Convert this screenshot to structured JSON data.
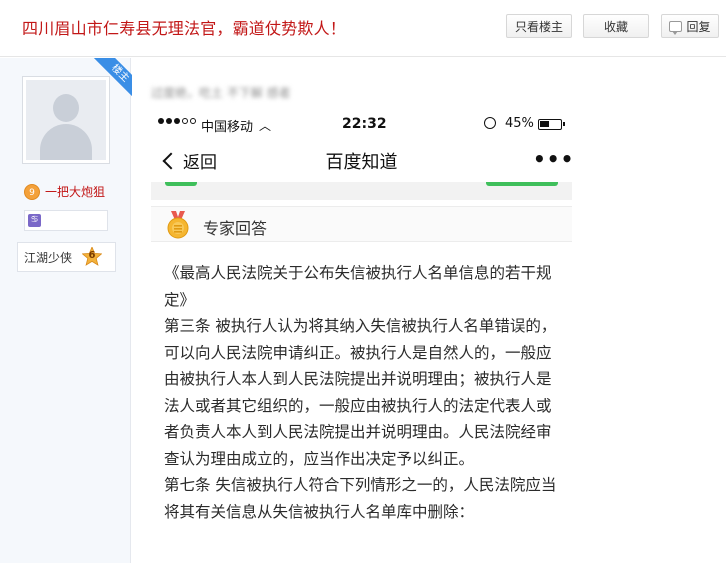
{
  "thread": {
    "title": "四川眉山市仁寿县无理法官，霸道仗势欺人！",
    "buttons": {
      "only_op": "只看楼主",
      "favorite": "收藏",
      "reply": "回复"
    }
  },
  "author": {
    "badge": "楼主",
    "medal_level": "9",
    "name": "一把大炮狙",
    "zodiac_icon_label": "♋",
    "rank_title": "江湖少侠",
    "rank_level": "6"
  },
  "post": {
    "blurred_line": "过度绝，吃土 不下解 感者",
    "phone": {
      "status": {
        "carrier": "中国移动",
        "wifi": "︿",
        "time": "22:32",
        "battery_pct": "45%"
      },
      "nav": {
        "back": "返回",
        "title": "百度知道",
        "more": "•••"
      },
      "expert_label": "专家回答",
      "answer_paragraphs": [
        "《最高人民法院关于公布失信被执行人名单信息的若干规定》",
        "第三条 被执行人认为将其纳入失信被执行人名单错误的，可以向人民法院申请纠正。被执行人是自然人的，一般应由被执行人本人到人民法院提出并说明理由；被执行人是法人或者其它组织的，一般应由被执行人的法定代表人或者负责人本人到人民法院提出并说明理由。人民法院经审查认为理由成立的，应当作出决定予以纠正。",
        "第七条  失信被执行人符合下列情形之一的，人民法院应当将其有关信息从失信被执行人名单库中删除："
      ]
    }
  },
  "colors": {
    "title_red": "#c21717",
    "ribbon_blue": "#3a8ee6",
    "sidebar_bg": "#f5f8fc",
    "accent_green": "#3fbf5b"
  }
}
